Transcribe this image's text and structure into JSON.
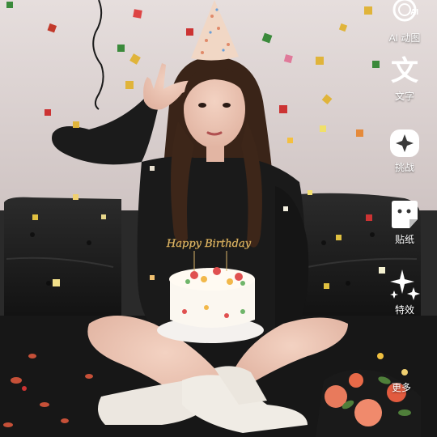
{
  "tools": [
    {
      "id": "ai",
      "label": "AI 动图",
      "icon": "ai-sparkle-icon",
      "badge": "AI"
    },
    {
      "id": "text",
      "label": "文字",
      "icon": "text-glyph-icon",
      "glyph": "文"
    },
    {
      "id": "challenge",
      "label": "挑战",
      "icon": "challenge-sparkle-icon"
    },
    {
      "id": "sticker",
      "label": "贴纸",
      "icon": "sticker-icon"
    },
    {
      "id": "effects",
      "label": "特效",
      "icon": "sparkles-icon"
    }
  ],
  "more": {
    "label": "更多",
    "icon": "chevron-down-icon"
  },
  "photo": {
    "cake_topper": "Happy Birthday",
    "colors": {
      "wall": "#ddd4d3",
      "sofa": "#1c1c1c",
      "sweater": "#1a1a1a",
      "hat": "#f1d7c5"
    }
  }
}
